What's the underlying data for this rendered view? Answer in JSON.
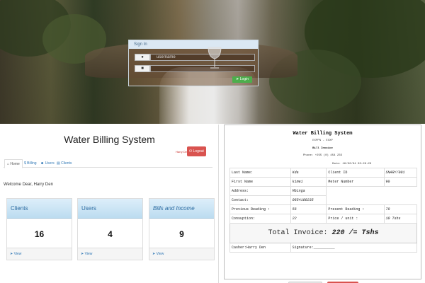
{
  "login": {
    "title": "Sign In",
    "username_placeholder": "username",
    "login_label": "Login"
  },
  "header": {
    "app_title": "Water Billing System",
    "user_name": "Harry Den",
    "logout_label": "Logout"
  },
  "tabs": [
    {
      "label": "Home",
      "icon": "home-icon"
    },
    {
      "label": "Billing",
      "icon": "dollar-icon"
    },
    {
      "label": "Users",
      "icon": "users-icon"
    },
    {
      "label": "Clients",
      "icon": "clients-icon"
    }
  ],
  "welcome": "Welcome Dear, Harry Den",
  "cards": [
    {
      "title": "Clients",
      "count": "16",
      "footer": "View"
    },
    {
      "title": "Users",
      "count": "4",
      "footer": "View"
    },
    {
      "title": "Bills and Income",
      "count": "9",
      "footer": "View"
    }
  ],
  "invoice": {
    "title": "Water Billing System",
    "sub": "EXPPN - EXXP",
    "bill_label": "Bill Invoice",
    "phone": "Phone: +255 (0) 454 235",
    "date": "Date: 16/02/04 03:28:20",
    "rows": {
      "last_name_label": "Last Name:",
      "last_name": "Kda",
      "client_id_label": "Client ID",
      "client_id": "SNARY/001",
      "first_name_label": "First Name",
      "first_name": "kimei",
      "meter_label": "Meter Number",
      "meter": "90",
      "address_label": "Address:",
      "address": "Mbinga",
      "contact_label": "Contact:",
      "contact": "0654100235",
      "prev_label": "Previous Reading :",
      "prev": "56",
      "present_label": "Present Reading :",
      "present": "78",
      "consumption_label": "Consuption:",
      "consumption": "22",
      "price_label": "Price / unit :",
      "price": "10 Tshs",
      "total_label": "Total Invoice:",
      "total_value": "220 /= Tshs",
      "cashier": "Casher:Harry Den",
      "signature": "Signature:__________"
    }
  },
  "colors": {
    "primary": "#337ab7",
    "danger": "#d9534f",
    "success": "#4cae4c",
    "card_head": "#bcdcf0"
  }
}
